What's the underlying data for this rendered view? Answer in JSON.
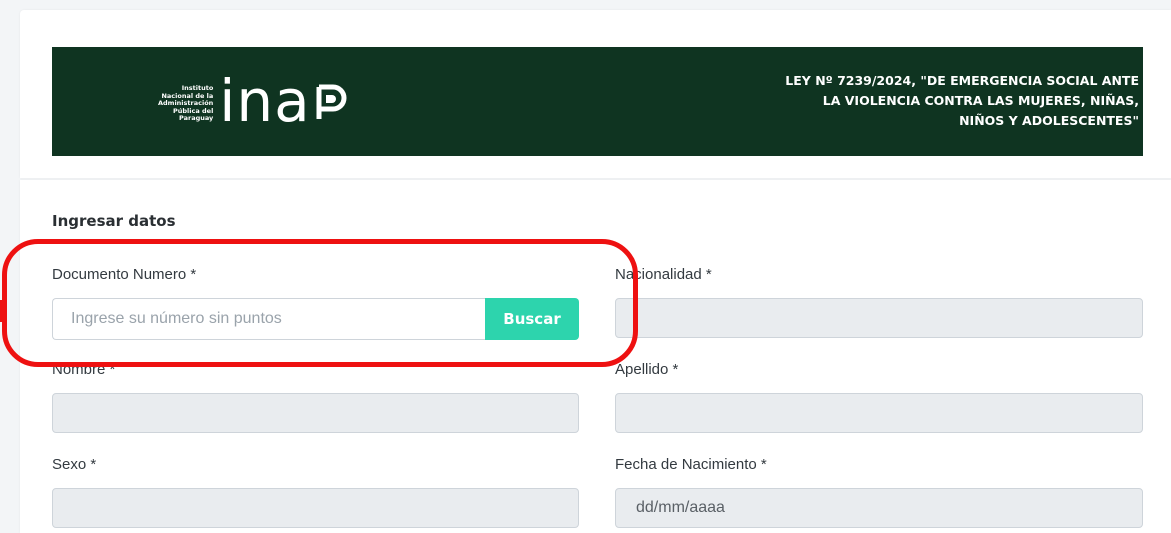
{
  "header": {
    "logo_small_lines": [
      "Instituto",
      "Nacional de la",
      "Administración",
      "Pública del",
      "Paraguay"
    ],
    "logo_text": "ina",
    "logo_mark": "p",
    "law_line1": "LEY Nº 7239/2024, \"DE EMERGENCIA SOCIAL ANTE",
    "law_line2": "LA VIOLENCIA CONTRA LAS MUJERES, NIÑAS,",
    "law_line3": "NIÑOS Y ADOLESCENTES\"",
    "banner_color": "#0f3421"
  },
  "form": {
    "section_title": "Ingresar datos",
    "documento": {
      "label": "Documento Numero *",
      "placeholder": "Ingrese su número sin puntos",
      "button_label": "Buscar",
      "button_color": "#2dd4ad"
    },
    "nacionalidad": {
      "label": "Nacionalidad *",
      "value": ""
    },
    "nombre": {
      "label": "Nombre *",
      "value": ""
    },
    "apellido": {
      "label": "Apellido *",
      "value": ""
    },
    "sexo": {
      "label": "Sexo *",
      "value": ""
    },
    "fecha_nacimiento": {
      "label": "Fecha de Nacimiento *",
      "value": "dd/mm/aaaa"
    }
  },
  "annotation": {
    "highlight_color": "#ee1111"
  }
}
